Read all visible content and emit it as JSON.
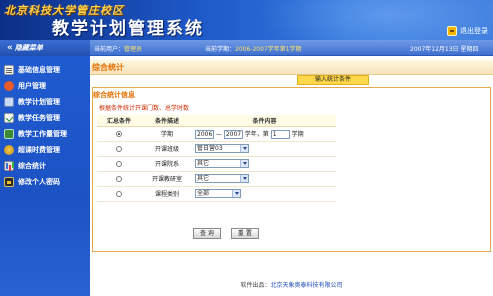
{
  "header": {
    "university": "北京科技大学管庄校区",
    "system_name": "教学计划管理系统",
    "logout_label": "退出登录"
  },
  "infobar": {
    "hide_menu_label": "隐藏菜单",
    "current_user_label": "当前用户：",
    "current_user_value": "管理员",
    "current_term_label": "当前学期：",
    "current_term_value": "2006-2007学年第1学期",
    "date": "2007年12月13日 星期四"
  },
  "sidebar": {
    "items": [
      {
        "label": "基础信息管理",
        "icon": "document-list-icon"
      },
      {
        "label": "用户管理",
        "icon": "user-icon"
      },
      {
        "label": "教学计划管理",
        "icon": "plan-icon"
      },
      {
        "label": "教学任务管理",
        "icon": "task-check-icon"
      },
      {
        "label": "教学工作量管理",
        "icon": "workload-icon"
      },
      {
        "label": "超课时费管理",
        "icon": "coin-icon"
      },
      {
        "label": "综合统计",
        "icon": "bar-chart-icon"
      },
      {
        "label": "修改个人密码",
        "icon": "password-icon"
      }
    ]
  },
  "main": {
    "page_title": "综合统计",
    "input_tab": "输入统计条件",
    "section_title": "综合统计信息",
    "tip": "根据条件统计开课门数、总学时数",
    "table": {
      "headers": [
        "汇总条件",
        "条件描述",
        "条件内容"
      ],
      "rows": [
        {
          "checked": true,
          "label": "学期"
        },
        {
          "checked": false,
          "label": "开课班级",
          "value": "管日营03"
        },
        {
          "checked": false,
          "label": "开课院系",
          "value": "其它"
        },
        {
          "checked": false,
          "label": "开课教研室",
          "value": "其它"
        },
        {
          "checked": false,
          "label": "课程类别",
          "value": "全部"
        }
      ],
      "term": {
        "start_year": "2006",
        "dash": "—",
        "end_year": "2007",
        "year_suffix": "学年，第",
        "term_no": "1",
        "term_suffix": "学期"
      }
    },
    "query_button": "查 询",
    "reset_button": "重 置"
  },
  "footer": {
    "label": "软件出品：",
    "value": "北京天象奥泰科技有限公司"
  },
  "colors": {
    "header_blue": "#1e59c8",
    "sidebar_blue": "#1f5bd0",
    "title_orange": "#e46e00",
    "tip_red": "#cc2a00",
    "highlight_yellow": "#ffd84a"
  }
}
